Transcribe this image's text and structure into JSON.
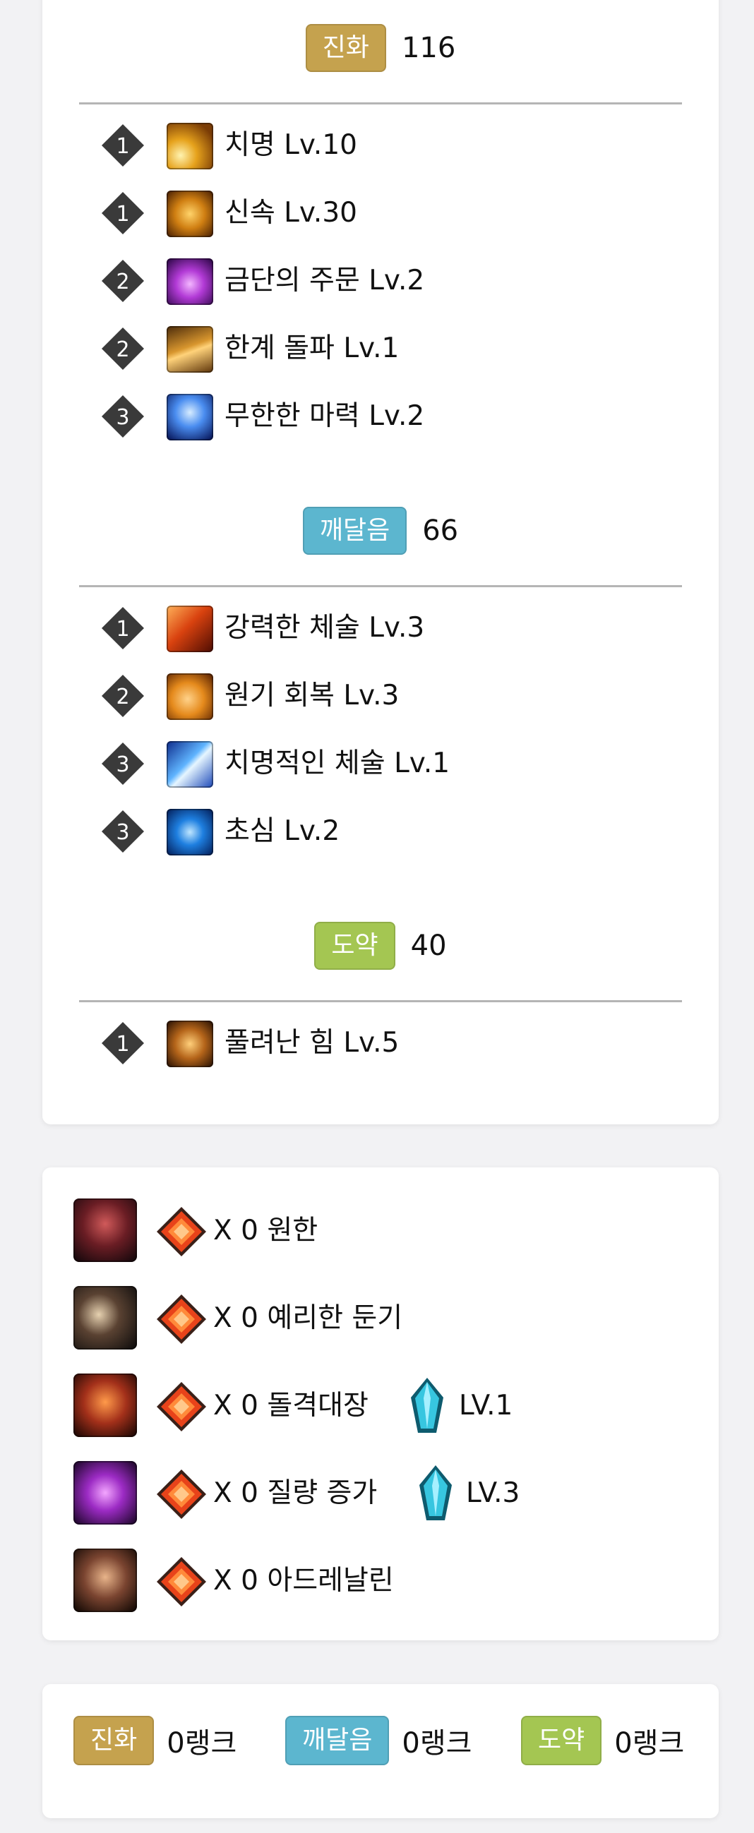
{
  "colors": {
    "evolution": "#c5a24e",
    "enlightenment": "#5cb6cf",
    "leap": "#a4c652"
  },
  "sections": [
    {
      "tag": "진화",
      "count": "116",
      "color_key": "evolution",
      "nodes": [
        {
          "tier": "1",
          "icon": "critical-icon",
          "label": "치명 Lv.10"
        },
        {
          "tier": "1",
          "icon": "swiftness-icon",
          "label": "신속 Lv.30"
        },
        {
          "tier": "2",
          "icon": "forbidden-spell-icon",
          "label": "금단의 주문 Lv.2"
        },
        {
          "tier": "2",
          "icon": "limit-break-icon",
          "label": "한계 돌파 Lv.1"
        },
        {
          "tier": "3",
          "icon": "infinite-mana-icon",
          "label": "무한한 마력 Lv.2"
        }
      ]
    },
    {
      "tag": "깨달음",
      "count": "66",
      "color_key": "enlightenment",
      "nodes": [
        {
          "tier": "1",
          "icon": "powerful-technique-icon",
          "label": "강력한 체술 Lv.3"
        },
        {
          "tier": "2",
          "icon": "vitality-recovery-icon",
          "label": "원기 회복 Lv.3"
        },
        {
          "tier": "3",
          "icon": "critical-technique-icon",
          "label": "치명적인 체술 Lv.1"
        },
        {
          "tier": "3",
          "icon": "beginner-mind-icon",
          "label": "초심 Lv.2"
        }
      ]
    },
    {
      "tag": "도약",
      "count": "40",
      "color_key": "leap",
      "nodes": [
        {
          "tier": "1",
          "icon": "unleashed-power-icon",
          "label": "풀려난 힘 Lv.5"
        }
      ]
    }
  ],
  "gems": [
    {
      "skill_icon": "grudge-skill-icon",
      "text": "X 0 원한",
      "level": ""
    },
    {
      "skill_icon": "keen-blunt-skill-icon",
      "text": "X 0 예리한 둔기",
      "level": ""
    },
    {
      "skill_icon": "raid-captain-skill-icon",
      "text": "X 0 돌격대장",
      "level": "LV.1"
    },
    {
      "skill_icon": "mass-increase-skill-icon",
      "text": "X 0 질량 증가",
      "level": "LV.3"
    },
    {
      "skill_icon": "adrenaline-skill-icon",
      "text": "X 0 아드레날린",
      "level": ""
    }
  ],
  "ranks": [
    {
      "tag": "진화",
      "value": "0랭크",
      "color_key": "evolution"
    },
    {
      "tag": "깨달음",
      "value": "0랭크",
      "color_key": "enlightenment"
    },
    {
      "tag": "도약",
      "value": "0랭크",
      "color_key": "leap"
    }
  ]
}
